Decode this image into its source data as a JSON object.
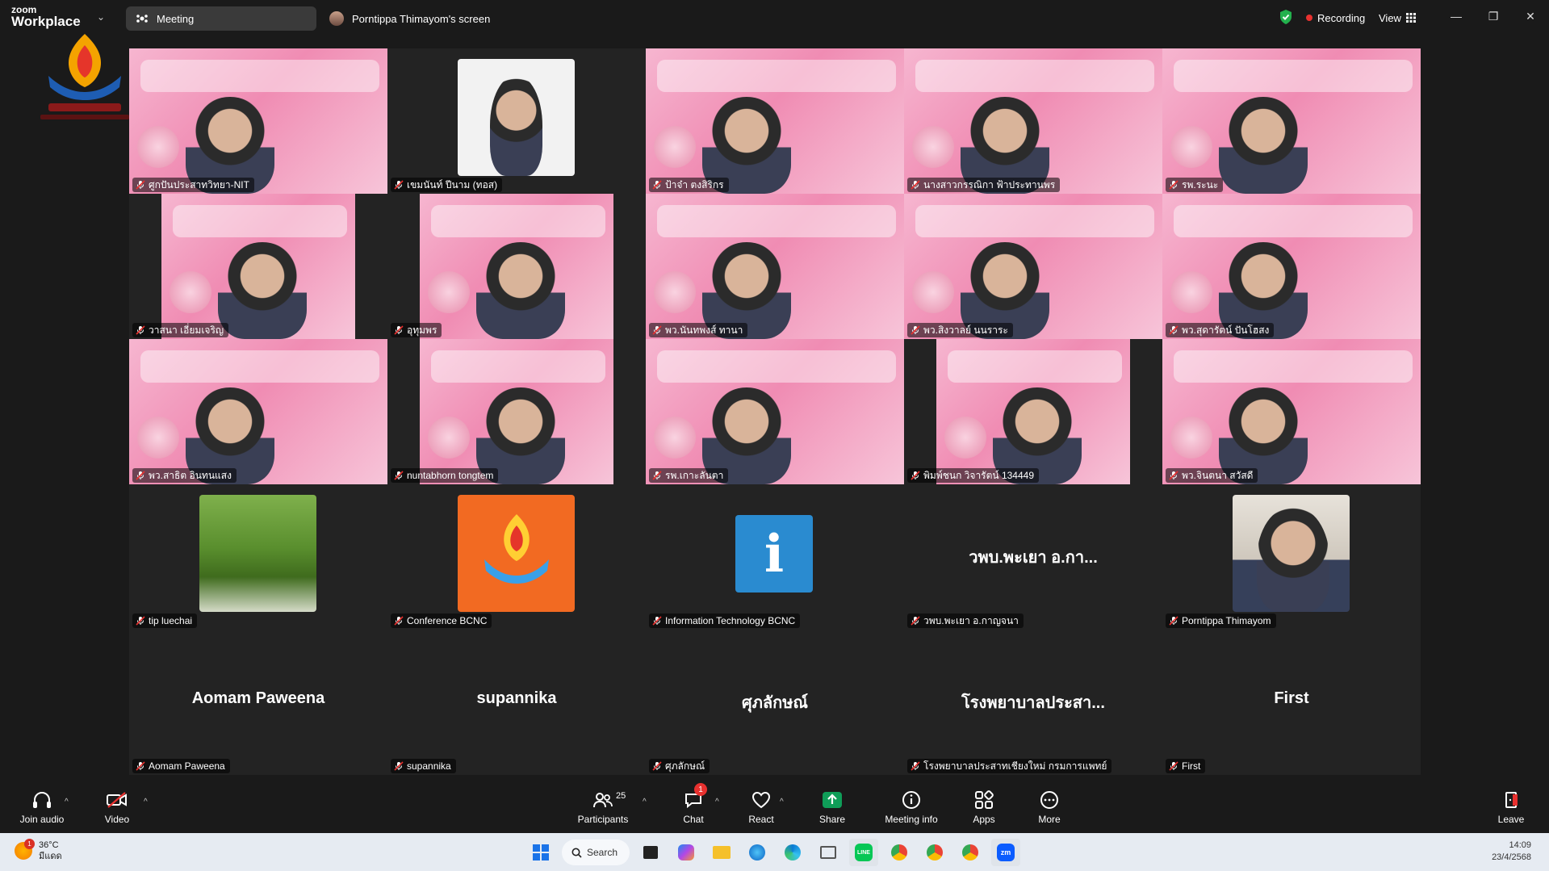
{
  "app": {
    "brand_small": "zoom",
    "brand_large": "Workplace"
  },
  "tabs": [
    {
      "label": "Meeting"
    },
    {
      "label": "Porntippa Thimayom's screen"
    }
  ],
  "header": {
    "recording": "Recording",
    "view": "View"
  },
  "participants": [
    {
      "name": "ศูกปันประสาทวิทยา-NIT",
      "type": "pink",
      "active": true
    },
    {
      "name": "เขมนันท์ ปีนาม (ทอส)",
      "type": "cam-dark"
    },
    {
      "name": "ป้าจ๋า ตงสิริกร",
      "type": "pink"
    },
    {
      "name": "นางสาวกรรณิกา ฟ้าประทานพร",
      "type": "pink"
    },
    {
      "name": "รพ.ระนะ",
      "type": "pink"
    },
    {
      "name": "วาสนา เอี่ยมเจริญ",
      "type": "pink-narrow"
    },
    {
      "name": "อุทุมพร",
      "type": "pink-narrow"
    },
    {
      "name": "พว.นันทพงส์ ทานา",
      "type": "pink"
    },
    {
      "name": "พว.สิงวาลย์ นนราระ",
      "type": "pink"
    },
    {
      "name": "พว.สุดารัตน์ ปันโฮสง",
      "type": "pink"
    },
    {
      "name": "พว.สาธิต อินทนแสง",
      "type": "pink"
    },
    {
      "name": "nuntabhorn tongtem",
      "type": "pink-narrow"
    },
    {
      "name": "รพ.เกาะลันตา",
      "type": "pink"
    },
    {
      "name": "พิมพ์ชนก วิจารัตน์ 134449",
      "type": "pink-narrow"
    },
    {
      "name": "พว.จินตนา สวัสดี",
      "type": "pink"
    },
    {
      "name": "tip luechai",
      "type": "photo-tree"
    },
    {
      "name": "Conference BCNC",
      "type": "photo-logo"
    },
    {
      "name": "Information Technology BCNC",
      "type": "photo-it"
    },
    {
      "name": "วพบ.พะเยา อ.กาญจนา",
      "type": "text",
      "display": "วพบ.พะเยา อ.กา..."
    },
    {
      "name": "Porntippa Thimayom",
      "type": "photo-face"
    },
    {
      "name": "Aomam Paweena",
      "type": "text",
      "display": "Aomam Paweena"
    },
    {
      "name": "supannika",
      "type": "text",
      "display": "supannika"
    },
    {
      "name": "ศุภลักษณ์",
      "type": "text",
      "display": "ศุภลักษณ์"
    },
    {
      "name": "โรงพยาบาลประสาทเชียงใหม่ กรมการแพทย์",
      "type": "text",
      "display": "โรงพยาบาลประสา..."
    },
    {
      "name": "First",
      "type": "text",
      "display": "First"
    }
  ],
  "toolbar": {
    "join_audio": "Join audio",
    "video": "Video",
    "participants": "Participants",
    "participants_count": "25",
    "chat": "Chat",
    "chat_badge": "1",
    "react": "React",
    "share": "Share",
    "meeting_info": "Meeting info",
    "apps": "Apps",
    "more": "More",
    "leave": "Leave"
  },
  "taskbar": {
    "temperature": "36°C",
    "weather_text": "มีแดด",
    "weather_badge": "1",
    "search": "Search",
    "time": "14:09",
    "date": "23/4/2568"
  },
  "colors": {
    "accent_green": "#23d959",
    "share_green": "#0f9d58",
    "recording_red": "#e8312f"
  }
}
